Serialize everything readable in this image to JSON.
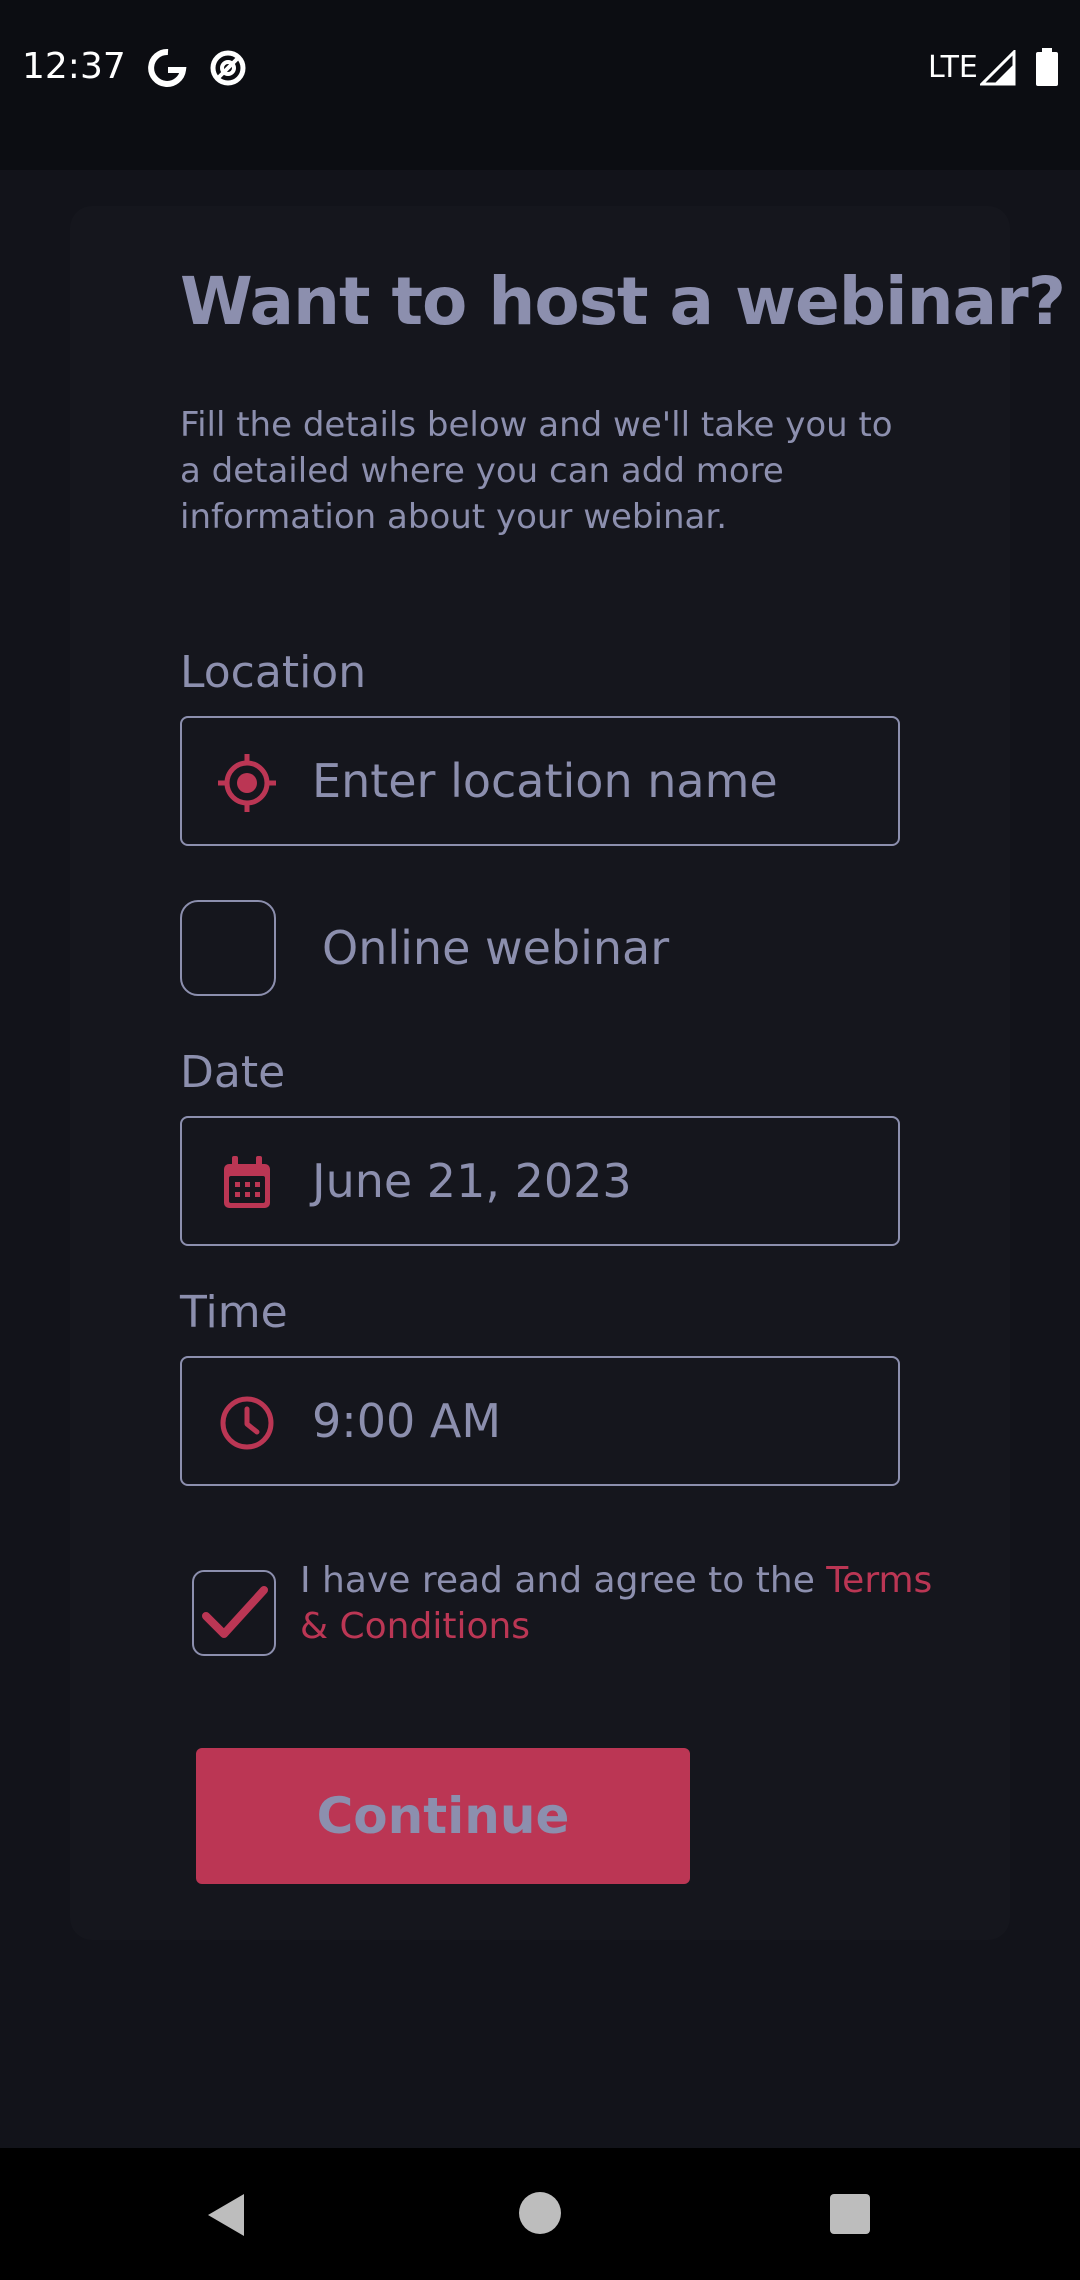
{
  "status_bar": {
    "time": "12:37",
    "network": "LTE",
    "icons": [
      "google-icon",
      "at-sign-icon",
      "signal-icon",
      "battery-icon"
    ]
  },
  "form": {
    "title": "Want to host a webinar?",
    "subtitle": "Fill the details below and we'll take you to a detailed where you can add more information about your webinar.",
    "location": {
      "label": "Location",
      "placeholder": "Enter location name",
      "icon": "location-target-icon"
    },
    "online": {
      "label": "Online webinar",
      "checked": false
    },
    "date": {
      "label": "Date",
      "value": "June 21, 2023",
      "icon": "calendar-icon"
    },
    "time": {
      "label": "Time",
      "value": "9:00 AM",
      "icon": "clock-icon"
    },
    "terms": {
      "prefix": "I have read and agree to the ",
      "link": "Terms & Conditions",
      "checked": true
    },
    "continue_label": "Continue"
  },
  "colors": {
    "background": "#12131a",
    "card": "#15161d",
    "text": "#8c8fae",
    "accent": "#bb3654"
  },
  "nav_bar": {
    "icons": [
      "back-icon",
      "home-icon",
      "recents-icon"
    ]
  }
}
